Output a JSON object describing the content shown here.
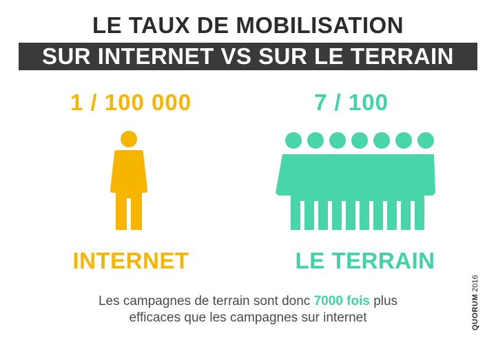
{
  "title": {
    "line1": "LE TAUX DE MOBILISATION",
    "line2": "SUR INTERNET VS SUR LE TERRAIN"
  },
  "left": {
    "ratio": "1 / 100 000",
    "label": "INTERNET",
    "people_count": 1,
    "color": "#f7b500"
  },
  "right": {
    "ratio": "7 / 100",
    "label": "LE TERRAIN",
    "people_count": 7,
    "color": "#3fd3a5"
  },
  "caption": {
    "before": "Les campagnes de  terrain sont donc",
    "highlight": "7000 fois",
    "after": "plus",
    "line2": "efficaces que les campagnes sur internet"
  },
  "credit": {
    "brand": "QUORUM",
    "year": "2016"
  }
}
